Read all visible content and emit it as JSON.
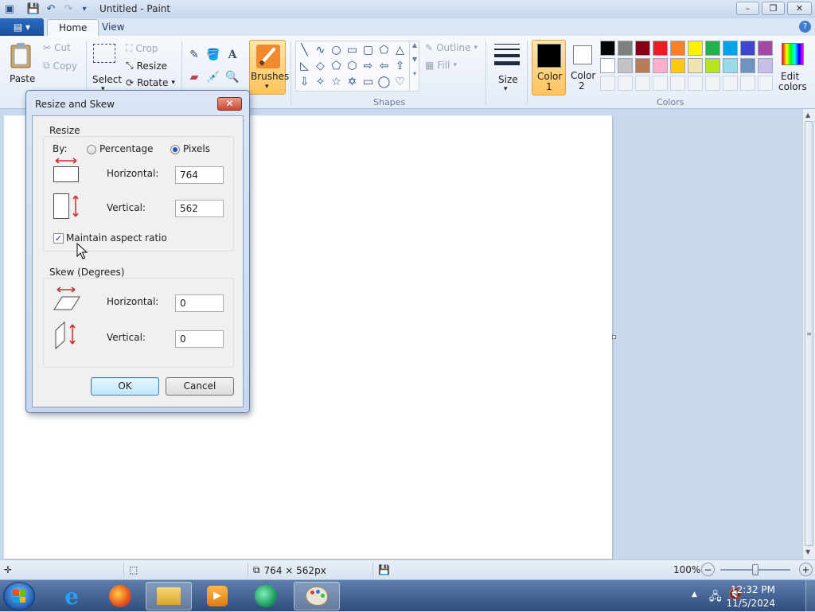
{
  "window": {
    "title": "Untitled - Paint",
    "min": "–",
    "max": "❐",
    "close": "✕"
  },
  "ribbon_tabs": {
    "home": "Home",
    "view": "View"
  },
  "ribbon": {
    "clipboard": {
      "paste": "Paste",
      "cut": "Cut",
      "copy": "Copy"
    },
    "image": {
      "select": "Select",
      "crop": "Crop",
      "resize": "Resize",
      "rotate": "Rotate"
    },
    "brushes": "Brushes",
    "shapes": {
      "label": "Shapes",
      "outline": "Outline",
      "fill": "Fill"
    },
    "size": "Size",
    "color1": {
      "line1": "Color",
      "line2": "1"
    },
    "color2": {
      "line1": "Color",
      "line2": "2"
    },
    "colors_label": "Colors",
    "edit_colors": {
      "line1": "Edit",
      "line2": "colors"
    },
    "palette_row1": [
      "#000000",
      "#7f7f7f",
      "#880015",
      "#ed1c24",
      "#ff7f27",
      "#fff200",
      "#22b14c",
      "#00a2e8",
      "#3f48cc",
      "#a349a4"
    ],
    "palette_row2": [
      "#ffffff",
      "#c3c3c3",
      "#b97a57",
      "#ffaec9",
      "#ffc90e",
      "#efe4b0",
      "#b5e61d",
      "#99d9ea",
      "#7092be",
      "#c8bfe7"
    ],
    "active_color1": "#000000",
    "active_color2": "#ffffff"
  },
  "dialog": {
    "title": "Resize and Skew",
    "close": "✕",
    "resize": {
      "legend": "Resize",
      "by_label": "By:",
      "percentage_label": "Percentage",
      "pixels_label": "Pixels",
      "selected_unit": "Pixels",
      "horizontal_label": "Horizontal:",
      "horizontal_value": "764",
      "vertical_label": "Vertical:",
      "vertical_value": "562",
      "maintain_label": "Maintain aspect ratio",
      "maintain_checked": true
    },
    "skew": {
      "legend": "Skew (Degrees)",
      "horizontal_label": "Horizontal:",
      "horizontal_value": "0",
      "vertical_label": "Vertical:",
      "vertical_value": "0"
    },
    "ok": "OK",
    "cancel": "Cancel"
  },
  "statusbar": {
    "dimensions": "764 × 562px",
    "zoom": "100%"
  },
  "taskbar": {
    "time": "12:32 PM",
    "date": "11/5/2024"
  }
}
